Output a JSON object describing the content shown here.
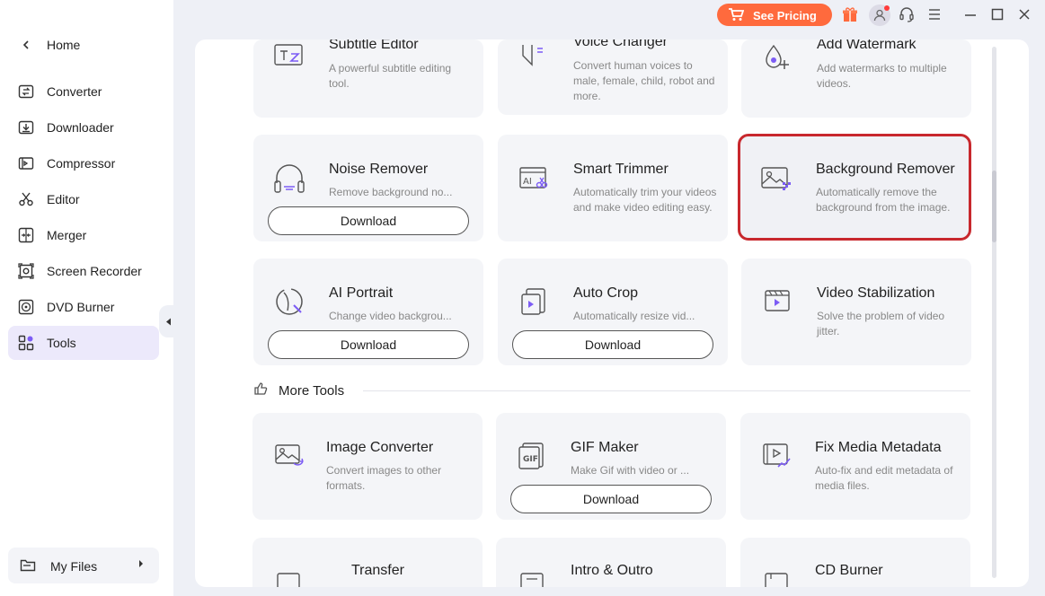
{
  "sidebar": {
    "home": "Home",
    "items": [
      {
        "label": "Converter",
        "icon": "converter-icon"
      },
      {
        "label": "Downloader",
        "icon": "downloader-icon"
      },
      {
        "label": "Compressor",
        "icon": "compressor-icon"
      },
      {
        "label": "Editor",
        "icon": "scissors-icon"
      },
      {
        "label": "Merger",
        "icon": "merger-icon"
      },
      {
        "label": "Screen Recorder",
        "icon": "screen-recorder-icon"
      },
      {
        "label": "DVD Burner",
        "icon": "disc-icon"
      },
      {
        "label": "Tools",
        "icon": "tools-grid-icon"
      }
    ],
    "active": "Tools",
    "my_files": "My Files"
  },
  "titlebar": {
    "pricing_label": "See Pricing"
  },
  "colors": {
    "accent": "#7c5cf5",
    "pricing": "#ff6a3d",
    "highlight": "#c8282d",
    "active_nav": "#ece9fb"
  },
  "cards": {
    "subtitle_editor": {
      "title": "Subtitle Editor",
      "desc": "A powerful subtitle editing tool."
    },
    "voice_changer": {
      "title": "Voice Changer",
      "desc": "Convert human voices to male, female, child, robot and more."
    },
    "add_watermark": {
      "title": "Add Watermark",
      "desc": "Add watermarks to multiple videos."
    },
    "noise_remover": {
      "title": "Noise Remover",
      "desc": "Remove background no...",
      "button": "Download"
    },
    "smart_trimmer": {
      "title": "Smart Trimmer",
      "desc": "Automatically trim your videos and make video editing easy."
    },
    "background_remover": {
      "title": "Background Remover",
      "desc": "Automatically remove the background from the image."
    },
    "ai_portrait": {
      "title": "AI Portrait",
      "desc": "Change video backgrou...",
      "button": "Download"
    },
    "auto_crop": {
      "title": "Auto Crop",
      "desc": "Automatically resize vid...",
      "button": "Download"
    },
    "video_stabilization": {
      "title": "Video Stabilization",
      "desc": "Solve the problem of video jitter."
    },
    "image_converter": {
      "title": "Image Converter",
      "desc": "Convert images to other formats."
    },
    "gif_maker": {
      "title": "GIF Maker",
      "desc": "Make Gif with video or ...",
      "button": "Download"
    },
    "fix_media_metadata": {
      "title": "Fix Media Metadata",
      "desc": "Auto-fix and edit metadata of media files."
    },
    "transfer": {
      "title": "Transfer"
    },
    "intro_outro": {
      "title": "Intro & Outro"
    },
    "cd_burner": {
      "title": "CD Burner"
    }
  },
  "more_tools": "More Tools"
}
